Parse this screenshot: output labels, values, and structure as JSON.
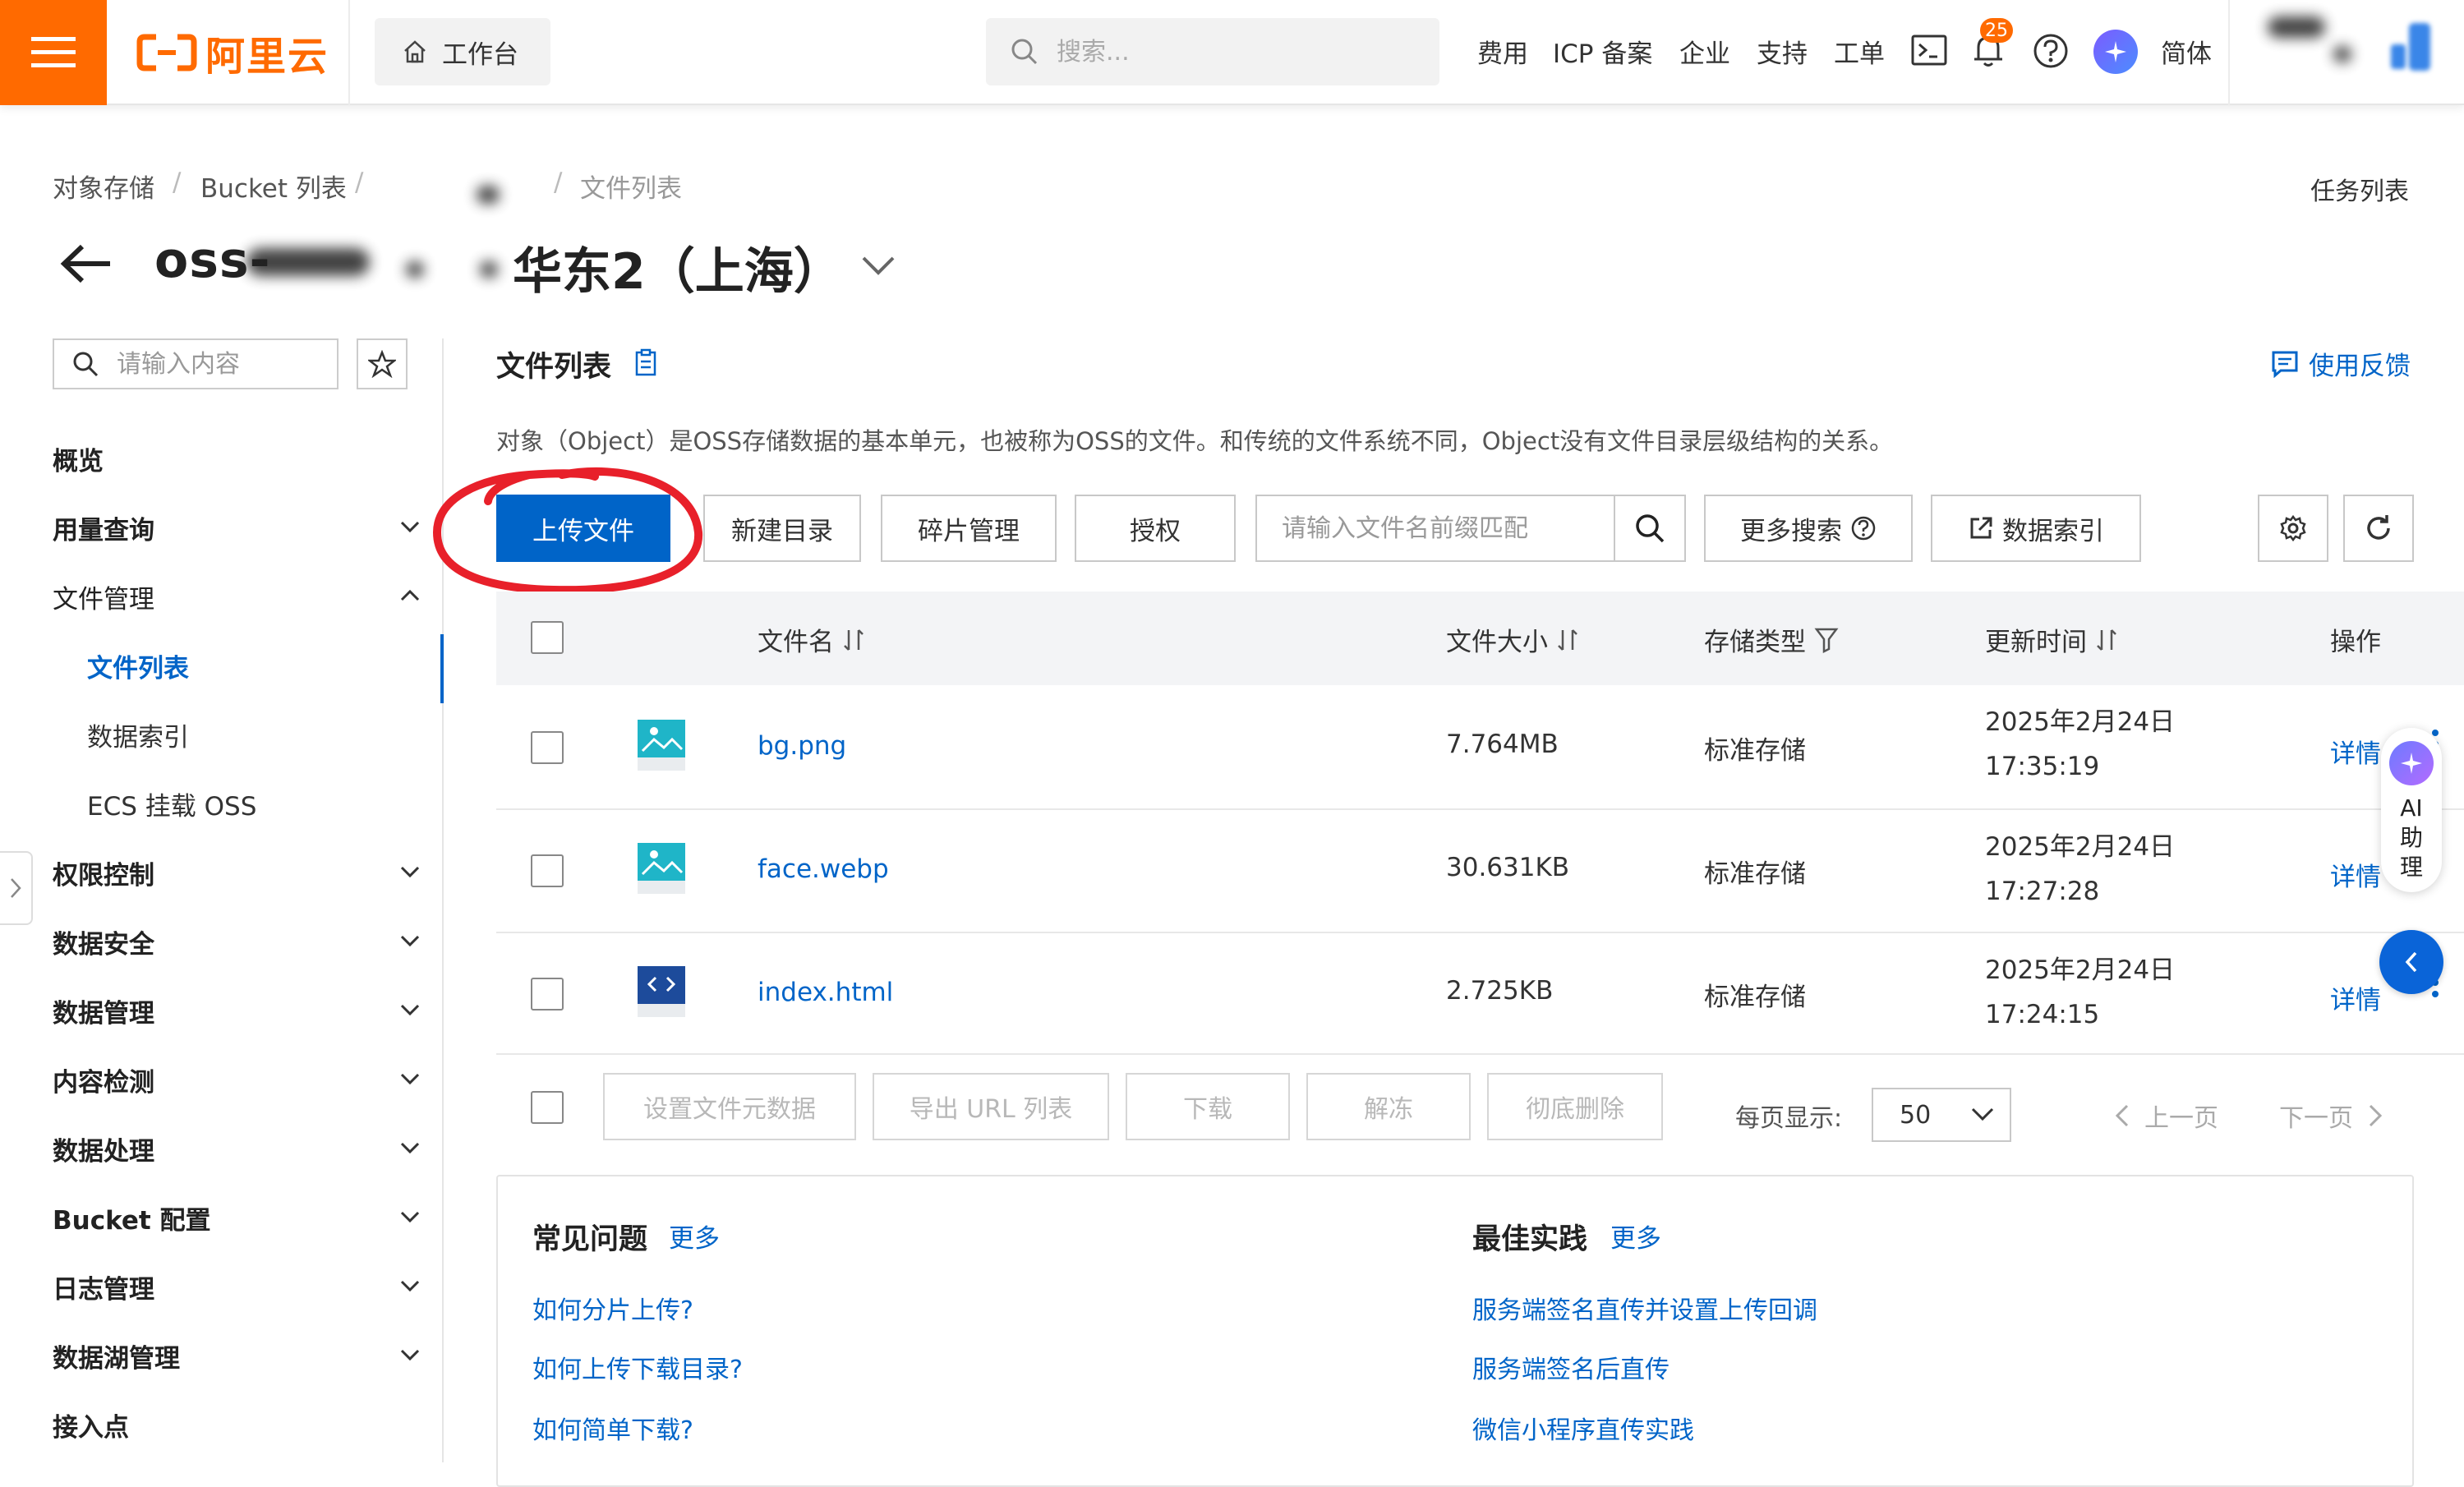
{
  "topbar": {
    "brand": "阿里云",
    "workbench": "工作台",
    "search_placeholder": "搜索...",
    "nav": [
      "费用",
      "ICP 备案",
      "企业",
      "支持",
      "工单"
    ],
    "notification_count": "25",
    "language": "简体",
    "accent_color": "#ff6a00"
  },
  "breadcrumb": {
    "items": [
      "对象存储",
      "Bucket 列表",
      "文件列表"
    ]
  },
  "header": {
    "bucket_prefix": "oss-",
    "region": "华东2（上海）",
    "task_list": "任务列表"
  },
  "sidebar": {
    "search_placeholder": "请输入内容",
    "items": [
      {
        "label": "概览"
      },
      {
        "label": "用量查询"
      },
      {
        "label": "文件管理"
      },
      {
        "label": "文件列表"
      },
      {
        "label": "数据索引"
      },
      {
        "label": "ECS 挂载 OSS"
      },
      {
        "label": "权限控制"
      },
      {
        "label": "数据安全"
      },
      {
        "label": "数据管理"
      },
      {
        "label": "内容检测"
      },
      {
        "label": "数据处理"
      },
      {
        "label": "Bucket 配置"
      },
      {
        "label": "日志管理"
      },
      {
        "label": "数据湖管理"
      },
      {
        "label": "接入点"
      }
    ]
  },
  "main": {
    "title": "文件列表",
    "feedback": "使用反馈",
    "description": "对象（Object）是OSS存储数据的基本单元，也被称为OSS的文件。和传统的文件系统不同，Object没有文件目录层级结构的关系。",
    "toolbar": {
      "upload": "上传文件",
      "new_dir": "新建目录",
      "fragments": "碎片管理",
      "authorize": "授权",
      "search_placeholder": "请输入文件名前缀匹配",
      "more_search": "更多搜索",
      "data_index": "数据索引"
    },
    "table": {
      "columns": [
        "文件名",
        "文件大小",
        "存储类型",
        "更新时间",
        "操作"
      ],
      "rows": [
        {
          "name": "bg.png",
          "size": "7.764MB",
          "storage": "标准存储",
          "date": "2025年2月24日",
          "time": "17:35:19",
          "action": "详情"
        },
        {
          "name": "face.webp",
          "size": "30.631KB",
          "storage": "标准存储",
          "date": "2025年2月24日",
          "time": "17:27:28",
          "action": "详情"
        },
        {
          "name": "index.html",
          "size": "2.725KB",
          "storage": "标准存储",
          "date": "2025年2月24日",
          "time": "17:24:15",
          "action": "详情"
        }
      ]
    },
    "batch": {
      "set_meta": "设置文件元数据",
      "export_url": "导出 URL 列表",
      "download": "下载",
      "unfreeze": "解冻",
      "delete": "彻底删除",
      "page_size_label": "每页显示:",
      "page_size": "50",
      "prev": "上一页",
      "next": "下一页"
    },
    "faq": {
      "title": "常见问题",
      "more": "更多",
      "links": [
        "如何分片上传?",
        "如何上传下载目录?",
        "如何简单下载?"
      ]
    },
    "best_practice": {
      "title": "最佳实践",
      "more": "更多",
      "links": [
        "服务端签名直传并设置上传回调",
        "服务端签名后直传",
        "微信小程序直传实践"
      ]
    }
  },
  "assistant": {
    "label": "AI 助理"
  },
  "colors": {
    "primary": "#0064c8",
    "highlight_circle": "#e8202a"
  }
}
